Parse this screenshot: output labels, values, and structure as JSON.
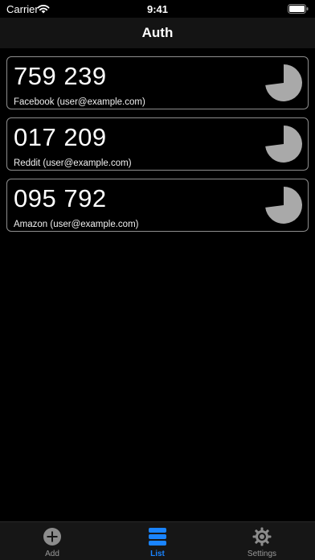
{
  "status_bar": {
    "carrier": "Carrier",
    "time": "9:41",
    "wifi_icon": "wifi-icon",
    "battery_icon": "battery-icon"
  },
  "nav": {
    "title": "Auth"
  },
  "tokens": [
    {
      "code": "759 239",
      "account": "Facebook (user@example.com)",
      "timer_icon": "countdown-pie-icon",
      "remaining_fraction": 0.73
    },
    {
      "code": "017 209",
      "account": "Reddit (user@example.com)",
      "timer_icon": "countdown-pie-icon",
      "remaining_fraction": 0.73
    },
    {
      "code": "095 792",
      "account": "Amazon (user@example.com)",
      "timer_icon": "countdown-pie-icon",
      "remaining_fraction": 0.73
    }
  ],
  "tab_bar": {
    "tabs": [
      {
        "label": "Add",
        "icon": "add-circle-icon",
        "selected": false
      },
      {
        "label": "List",
        "icon": "list-icon",
        "selected": true
      },
      {
        "label": "Settings",
        "icon": "gear-icon",
        "selected": false
      }
    ]
  },
  "colors": {
    "background": "#000000",
    "accent": "#1a84ff",
    "card_border": "#8e8e8e",
    "timer_fill": "#a9a9a9",
    "tab_inactive": "#9a9a9a"
  }
}
